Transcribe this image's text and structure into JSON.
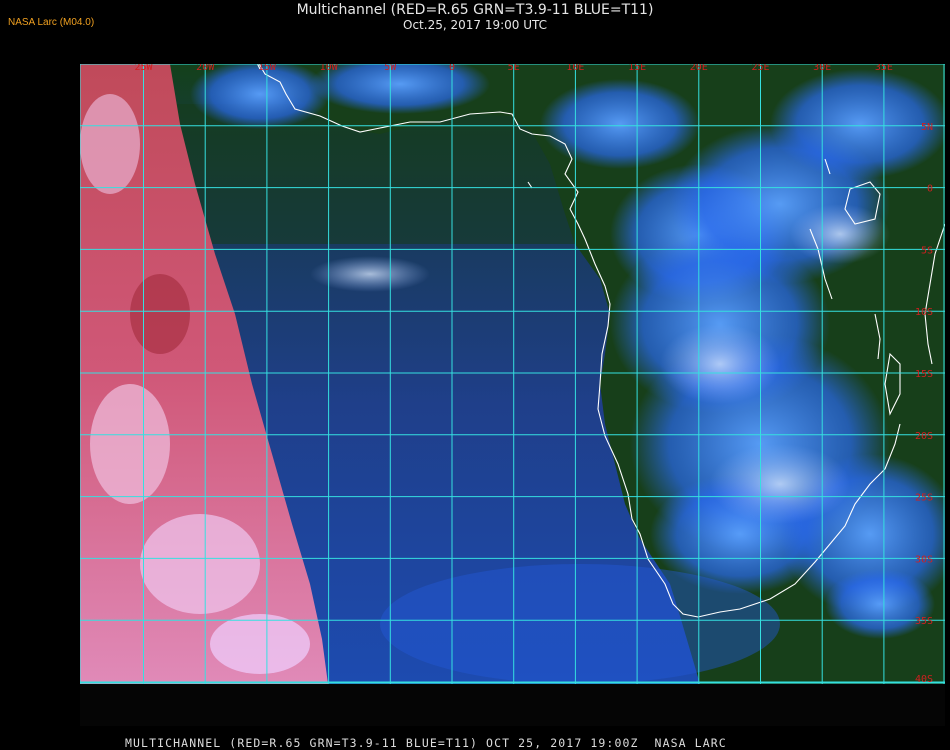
{
  "header": {
    "title": "Multichannel (RED=R.65 GRN=T3.9-11 BLUE=T11)",
    "subtitle": "Oct.25, 2017 19:00 UTC"
  },
  "corner_label": "NASA Larc (M04.0)",
  "footer": "MULTICHANNEL (RED=R.65 GRN=T3.9-11 BLUE=T11) OCT 25, 2017 19:00Z  NASA LARC",
  "map": {
    "lon_labels": [
      "25W",
      "20W",
      "15W",
      "10W",
      "5W",
      "0",
      "5E",
      "10E",
      "15E",
      "20E",
      "25E",
      "30E",
      "35E"
    ],
    "lat_labels": [
      "5N",
      "0",
      "5S",
      "10S",
      "15S",
      "20S",
      "25S",
      "30S",
      "35S",
      "40S"
    ],
    "colors": {
      "grid": "#35e0e0",
      "labels": "#d02020",
      "coast": "#ffffff",
      "ocean": "#1c3a7a",
      "land": "#1a4018",
      "cloud": "#3a80ff",
      "pink_region": "#d8507a"
    }
  }
}
